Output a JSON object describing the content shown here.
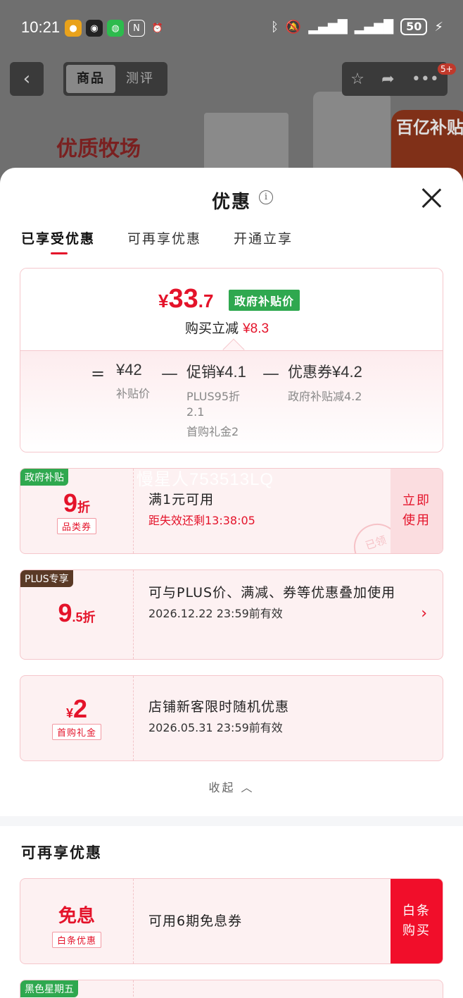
{
  "status_bar": {
    "time": "10:21",
    "battery": "50"
  },
  "product_page": {
    "tabs": [
      "商品",
      "测评"
    ],
    "cart_badge": "5+",
    "banner_text": "优质牧场",
    "promo_tag": "百亿补贴"
  },
  "sheet": {
    "title": "优惠",
    "tabs": [
      "已享受优惠",
      "可再享优惠",
      "开通立享"
    ],
    "summary": {
      "yen": "¥",
      "price_int": "33",
      "price_dec": ".7",
      "price_tag": "政府补贴价",
      "reduce_label": "购买立减",
      "reduce_value": "¥8.3",
      "equals": "=",
      "minus": "—",
      "col1_main": "¥42",
      "col1_sub": "补贴价",
      "col2_label": "促销",
      "col2_value": "¥4.1",
      "col2_sub1": "PLUS95折",
      "col2_sub2": "2.1",
      "col2_sub3": "首购礼金2",
      "col3_label": "优惠券",
      "col3_value": "¥4.2",
      "col3_sub": "政府补贴减4.2"
    },
    "coupons": [
      {
        "corner": "政府补贴",
        "big": "9",
        "unit": "折",
        "chip": "品类券",
        "title": "满1元可用",
        "countdown": "距失效还剩13:38:05",
        "action": [
          "立即",
          "使用"
        ],
        "stamp": "已领"
      },
      {
        "corner": "PLUS专享",
        "big": "9",
        "small": ".5",
        "unit": "折",
        "title": "可与PLUS价、满减、券等优惠叠加使用",
        "expiry": "2026.12.22  23:59前有效"
      },
      {
        "yen": "¥",
        "big": "2",
        "chip": "首购礼金",
        "title": "店铺新客限时随机优惠",
        "expiry": "2026.05.31  23:59前有效"
      }
    ],
    "watermark": "慢星人753513LQ",
    "collapse": "收起",
    "more_section_title": "可再享优惠",
    "more": [
      {
        "big": "免息",
        "chip": "白条优惠",
        "title": "可用6期免息券",
        "action": [
          "白条",
          "购买"
        ]
      },
      {
        "corner": "黑色星期五"
      }
    ]
  },
  "colors": {
    "accent": "#e4132a",
    "gov_green": "#2fa84f",
    "plus_brown": "#5a3a26",
    "coupon_bg": "#fdf1f2"
  }
}
